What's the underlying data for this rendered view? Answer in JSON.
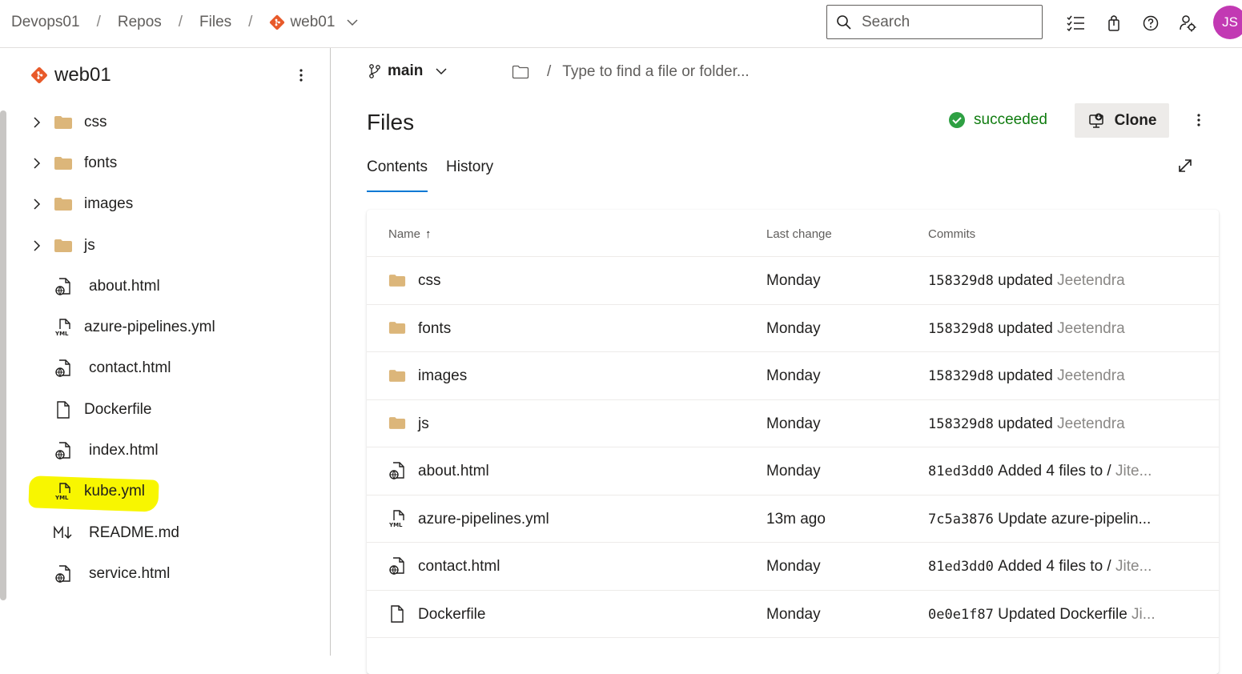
{
  "breadcrumb": {
    "items": [
      "Devops01",
      "Repos",
      "Files"
    ],
    "separator": "/",
    "repo": "web01"
  },
  "search": {
    "placeholder": "Search"
  },
  "user": {
    "initials": "JS",
    "avatar_color": "#c239b3"
  },
  "colors": {
    "accent": "#0078d4",
    "success": "#107c10",
    "git_brand": "#e85a2a",
    "folder": "#dcb67a"
  },
  "sidebar": {
    "repo_name": "web01",
    "tree": [
      {
        "label": "css",
        "type": "folder"
      },
      {
        "label": "fonts",
        "type": "folder"
      },
      {
        "label": "images",
        "type": "folder"
      },
      {
        "label": "js",
        "type": "folder"
      },
      {
        "label": "about.html",
        "type": "html"
      },
      {
        "label": "azure-pipelines.yml",
        "type": "yml"
      },
      {
        "label": "contact.html",
        "type": "html"
      },
      {
        "label": "Dockerfile",
        "type": "file"
      },
      {
        "label": "index.html",
        "type": "html"
      },
      {
        "label": "kube.yml",
        "type": "yml",
        "highlighted": true
      },
      {
        "label": "README.md",
        "type": "markdown"
      },
      {
        "label": "service.html",
        "type": "html"
      }
    ]
  },
  "main": {
    "branch": "main",
    "path_separator": "/",
    "path_placeholder": "Type to find a file or folder...",
    "title": "Files",
    "build_status": "succeeded",
    "clone_label": "Clone",
    "tabs": [
      {
        "label": "Contents",
        "active": true
      },
      {
        "label": "History",
        "active": false
      }
    ],
    "table": {
      "columns": {
        "name": "Name",
        "sort_indicator": "↑",
        "last_change": "Last change",
        "commits": "Commits"
      },
      "rows": [
        {
          "name": "css",
          "type": "folder",
          "last_change": "Monday",
          "hash": "158329d8",
          "message": "updated",
          "author": "Jeetendra"
        },
        {
          "name": "fonts",
          "type": "folder",
          "last_change": "Monday",
          "hash": "158329d8",
          "message": "updated",
          "author": "Jeetendra"
        },
        {
          "name": "images",
          "type": "folder",
          "last_change": "Monday",
          "hash": "158329d8",
          "message": "updated",
          "author": "Jeetendra"
        },
        {
          "name": "js",
          "type": "folder",
          "last_change": "Monday",
          "hash": "158329d8",
          "message": "updated",
          "author": "Jeetendra"
        },
        {
          "name": "about.html",
          "type": "html",
          "last_change": "Monday",
          "hash": "81ed3dd0",
          "message": "Added 4 files to /",
          "author": "Jite..."
        },
        {
          "name": "azure-pipelines.yml",
          "type": "yml",
          "last_change": "13m ago",
          "hash": "7c5a3876",
          "message": "Update azure-pipelin...",
          "author": ""
        },
        {
          "name": "contact.html",
          "type": "html",
          "last_change": "Monday",
          "hash": "81ed3dd0",
          "message": "Added 4 files to /",
          "author": "Jite..."
        },
        {
          "name": "Dockerfile",
          "type": "file",
          "last_change": "Monday",
          "hash": "0e0e1f87",
          "message": "Updated Dockerfile",
          "author": "Ji..."
        }
      ]
    }
  }
}
